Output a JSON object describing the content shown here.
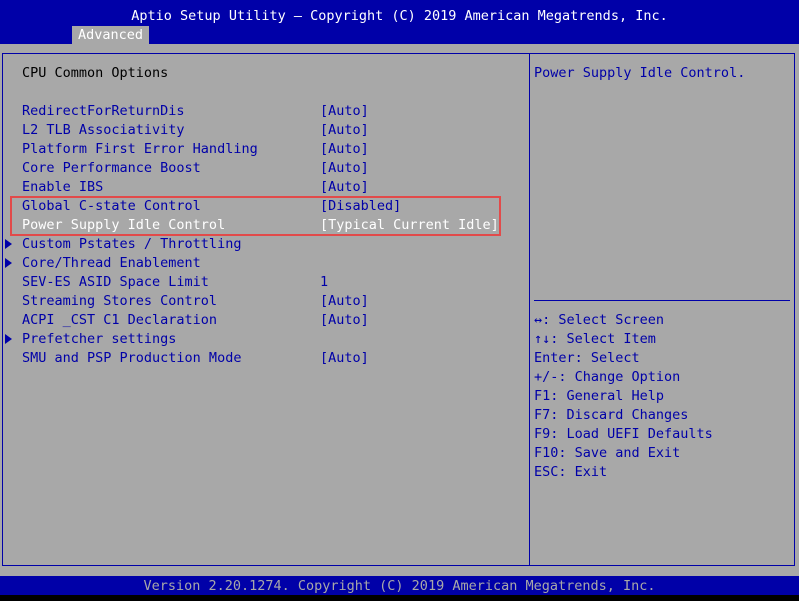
{
  "header": {
    "title": "Aptio Setup Utility – Copyright (C) 2019 American Megatrends, Inc.",
    "tab": "Advanced"
  },
  "main": {
    "section_title": "CPU Common Options",
    "items": [
      {
        "label": "RedirectForReturnDis",
        "value": "[Auto]"
      },
      {
        "label": "L2 TLB Associativity",
        "value": "[Auto]"
      },
      {
        "label": "Platform First Error Handling",
        "value": "[Auto]"
      },
      {
        "label": "Core Performance Boost",
        "value": "[Auto]"
      },
      {
        "label": "Enable IBS",
        "value": "[Auto]"
      },
      {
        "label": "Global C-state Control",
        "value": "[Disabled]"
      },
      {
        "label": "Power Supply Idle Control",
        "value": "[Typical Current Idle]"
      },
      {
        "label": "Custom Pstates / Throttling",
        "value": ""
      },
      {
        "label": "Core/Thread Enablement",
        "value": ""
      },
      {
        "label": "SEV-ES ASID Space Limit",
        "value": "1"
      },
      {
        "label": "Streaming Stores Control",
        "value": "[Auto]"
      },
      {
        "label": "ACPI _CST C1 Declaration",
        "value": "[Auto]"
      },
      {
        "label": "Prefetcher settings",
        "value": ""
      },
      {
        "label": "SMU and PSP Production Mode",
        "value": "[Auto]"
      }
    ]
  },
  "help": {
    "text": "Power Supply Idle Control.",
    "keys": [
      "↔: Select Screen",
      "↑↓: Select Item",
      "Enter: Select",
      "+/-: Change Option",
      "F1: General Help",
      "F7: Discard Changes",
      "F9: Load UEFI Defaults",
      "F10: Save and Exit",
      "ESC: Exit"
    ]
  },
  "footer": {
    "text": "Version 2.20.1274. Copyright (C) 2019 American Megatrends, Inc."
  },
  "colors": {
    "bios_blue": "#0000a8",
    "bios_gray": "#a8a8a8",
    "highlight_red": "#e24a4a",
    "selected_text": "#ffffff"
  },
  "icons": {
    "submenu": "triangle-right-icon"
  }
}
